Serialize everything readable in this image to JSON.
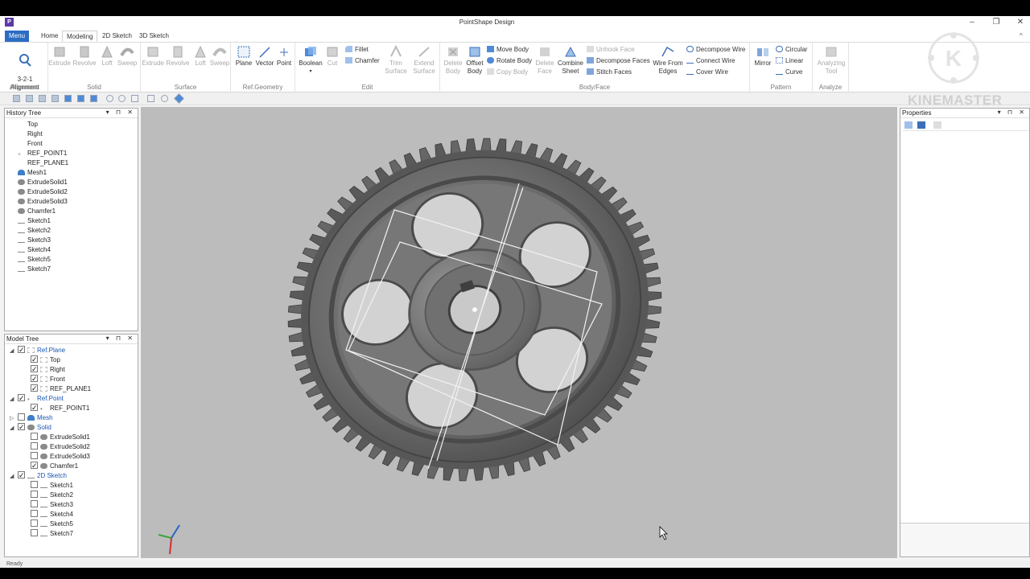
{
  "app": {
    "title": "PointShape Design",
    "icon_letter": "P"
  },
  "tabs": [
    "Menu",
    "Home",
    "Modeling",
    "2D Sketch",
    "3D Sketch"
  ],
  "active_tab": "Modeling",
  "ribbon": {
    "alignment": {
      "label": "Alignment",
      "btn": "3-2-1\nAlignment"
    },
    "solid": {
      "label": "Solid",
      "buttons": [
        "Extrude",
        "Revolve",
        "Loft",
        "Sweep"
      ]
    },
    "surface": {
      "label": "Surface",
      "buttons": [
        "Extrude",
        "Revolve",
        "Loft",
        "Sweep"
      ]
    },
    "refgeom": {
      "label": "Ref.Geometry",
      "buttons": [
        "Plane",
        "Vector",
        "Point"
      ]
    },
    "edit": {
      "label": "Edit",
      "boolean": "Boolean",
      "cut": "Cut",
      "fillet": "Fillet",
      "chamfer": "Chamfer",
      "trim": "Trim\nSurface",
      "extend": "Extend\nSurface"
    },
    "bodyface": {
      "label": "Body/Face",
      "delete_body": "Delete\nBody",
      "offset_body": "Offset\nBody",
      "move_body": "Move Body",
      "rotate_body": "Rotate Body",
      "copy_body": "Copy Body",
      "delete_face": "Delete\nFace",
      "combine_sheet": "Combine\nSheet",
      "unhook_face": "Unhook Face",
      "decompose_faces": "Decompose Faces",
      "stitch_faces": "Stitch Faces",
      "wire_from_edges": "Wire From\nEdges",
      "decompose_wire": "Decompose Wire",
      "connect_wire": "Connect Wire",
      "cover_wire": "Cover Wire"
    },
    "pattern": {
      "label": "Pattern",
      "mirror": "Mirror",
      "circular": "Circular",
      "linear": "Linear",
      "curve": "Curve"
    },
    "analyze": {
      "label": "Analyze",
      "tool": "Analyzing\nTool"
    }
  },
  "history_tree": {
    "title": "History Tree",
    "items": [
      "Top",
      "Right",
      "Front",
      "REF_POINT1",
      "REF_PLANE1",
      "Mesh1",
      "ExtrudeSolid1",
      "ExtrudeSolid2",
      "ExtrudeSolid3",
      "Chamfer1",
      "Sketch1",
      "Sketch2",
      "Sketch3",
      "Sketch4",
      "Sketch5",
      "Sketch7"
    ]
  },
  "model_tree": {
    "title": "Model Tree",
    "items": [
      {
        "label": "Ref.Plane",
        "level": 0,
        "checked": true,
        "group": true
      },
      {
        "label": "Top",
        "level": 1,
        "checked": true
      },
      {
        "label": "Right",
        "level": 1,
        "checked": true
      },
      {
        "label": "Front",
        "level": 1,
        "checked": true
      },
      {
        "label": "REF_PLANE1",
        "level": 1,
        "checked": true
      },
      {
        "label": "Ref.Point",
        "level": 0,
        "checked": true,
        "group": true
      },
      {
        "label": "REF_POINT1",
        "level": 1,
        "checked": true
      },
      {
        "label": "Mesh",
        "level": 0,
        "checked": false,
        "group": true
      },
      {
        "label": "Solid",
        "level": 0,
        "checked": true,
        "group": true
      },
      {
        "label": "ExtrudeSolid1",
        "level": 1,
        "checked": false
      },
      {
        "label": "ExtrudeSolid2",
        "level": 1,
        "checked": false
      },
      {
        "label": "ExtrudeSolid3",
        "level": 1,
        "checked": false
      },
      {
        "label": "Chamfer1",
        "level": 1,
        "checked": true
      },
      {
        "label": "2D Sketch",
        "level": 0,
        "checked": true,
        "group": true
      },
      {
        "label": "Sketch1",
        "level": 1,
        "checked": false
      },
      {
        "label": "Sketch2",
        "level": 1,
        "checked": false
      },
      {
        "label": "Sketch3",
        "level": 1,
        "checked": false
      },
      {
        "label": "Sketch4",
        "level": 1,
        "checked": false
      },
      {
        "label": "Sketch5",
        "level": 1,
        "checked": false
      },
      {
        "label": "Sketch7",
        "level": 1,
        "checked": false
      }
    ]
  },
  "properties": {
    "title": "Properties"
  },
  "status": {
    "text": "Ready"
  },
  "watermark": {
    "text": "KINEMASTER",
    "letter": "K"
  },
  "colors": {
    "menu_tab": "#2b6cc4",
    "viewport_bg": "#bcbcbc",
    "gear": "#6a6a6a"
  }
}
